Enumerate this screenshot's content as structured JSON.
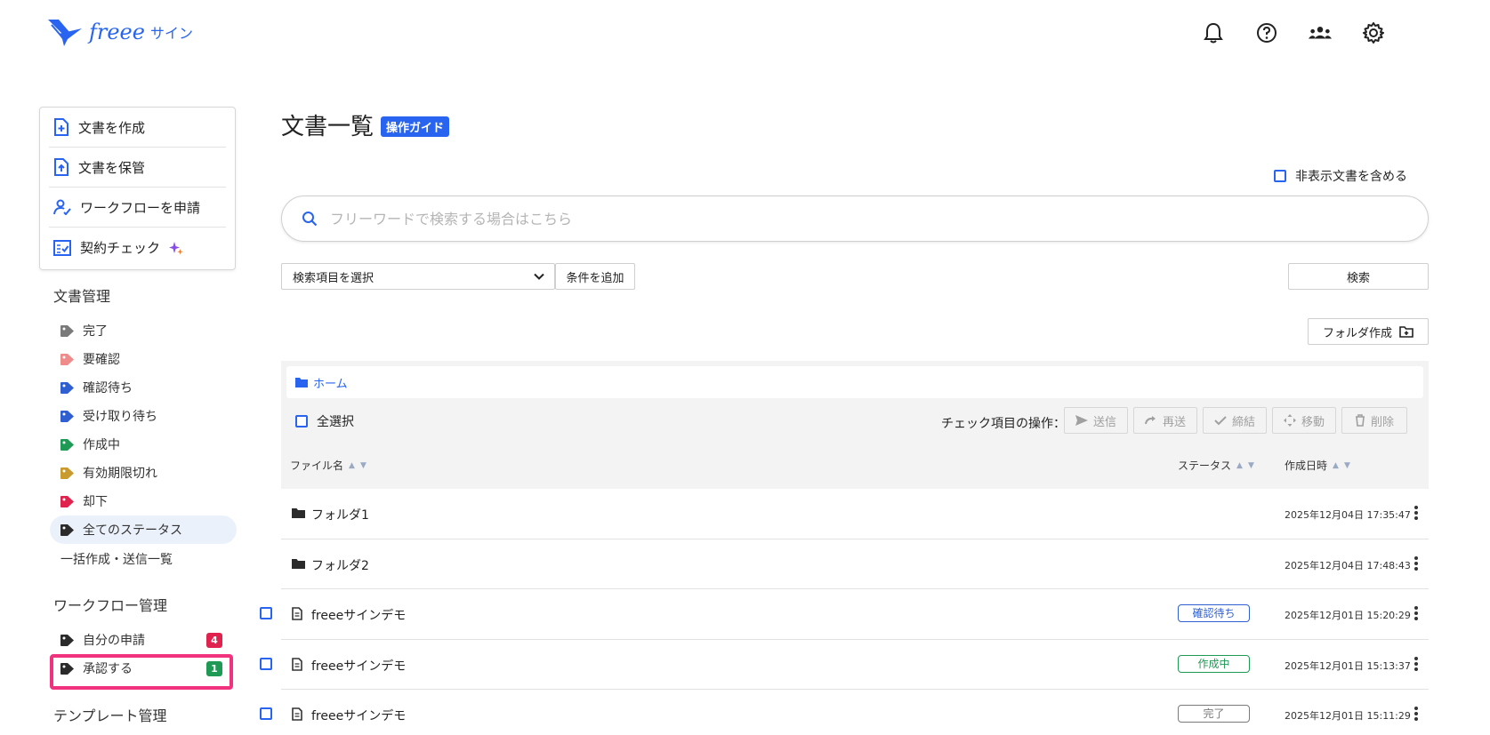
{
  "header": {
    "logo_text": "freee",
    "logo_sub": "サイン",
    "icons": [
      "bell-icon",
      "help-icon",
      "members-icon",
      "settings-icon"
    ]
  },
  "sidebar": {
    "card_items": [
      {
        "label": "文書を作成",
        "icon": "document-add-icon"
      },
      {
        "label": "文書を保管",
        "icon": "document-upload-icon"
      },
      {
        "label": "ワークフローを申請",
        "icon": "workflow-user-icon"
      },
      {
        "label": "契約チェック",
        "icon": "contract-check-icon"
      }
    ],
    "doc_mgmt_title": "文書管理",
    "doc_tags": [
      {
        "label": "完了",
        "color": "#7a7a7a"
      },
      {
        "label": "要確認",
        "color": "#f08b8b"
      },
      {
        "label": "確認待ち",
        "color": "#2f5fd0"
      },
      {
        "label": "受け取り待ち",
        "color": "#2f5fd0"
      },
      {
        "label": "作成中",
        "color": "#1f9a55"
      },
      {
        "label": "有効期限切れ",
        "color": "#c99a2e"
      },
      {
        "label": "却下",
        "color": "#e0234e"
      },
      {
        "label": "全てのステータス",
        "color": "#2b2b2b"
      }
    ],
    "bulk_link": "一括作成・送信一覧",
    "workflow_title": "ワークフロー管理",
    "workflow_items": [
      {
        "label": "自分の申請",
        "badge": "4",
        "badge_color": "#e0234e"
      },
      {
        "label": "承認する",
        "badge": "1",
        "badge_color": "#1f9a55"
      }
    ],
    "template_title": "テンプレート管理"
  },
  "main": {
    "title": "文書一覧",
    "guide_badge": "操作ガイド",
    "hidden_docs_label": "非表示文書を含める",
    "search_placeholder": "フリーワードで検索する場合はこちら",
    "select_label": "検索項目を選択",
    "add_condition": "条件を追加",
    "search_button": "検索",
    "create_folder": "フォルダ作成",
    "breadcrumb_home": "ホーム",
    "select_all": "全選択",
    "ops_label": "チェック項目の操作：",
    "ops": [
      {
        "label": "送信",
        "icon": "send-icon"
      },
      {
        "label": "再送",
        "icon": "resend-icon"
      },
      {
        "label": "締結",
        "icon": "check-icon"
      },
      {
        "label": "移動",
        "icon": "move-icon"
      },
      {
        "label": "削除",
        "icon": "trash-icon"
      }
    ],
    "columns": {
      "name": "ファイル名",
      "status": "ステータス",
      "created": "作成日時"
    },
    "rows": [
      {
        "type": "folder",
        "name": "フォルダ1",
        "status": "",
        "date": "2025年12月04日 17:35:47"
      },
      {
        "type": "folder",
        "name": "フォルダ2",
        "status": "",
        "date": "2025年12月04日 17:48:43"
      },
      {
        "type": "file",
        "name": "freeeサインデモ",
        "status": "確認待ち",
        "status_color": "#2f5fd0",
        "date": "2025年12月01日 15:20:29"
      },
      {
        "type": "file",
        "name": "freeeサインデモ",
        "status": "作成中",
        "status_color": "#1f9a55",
        "date": "2025年12月01日 15:13:37"
      },
      {
        "type": "file",
        "name": "freeeサインデモ",
        "status": "完了",
        "status_color": "#7a7a7a",
        "date": "2025年12月01日 15:11:29"
      }
    ]
  }
}
